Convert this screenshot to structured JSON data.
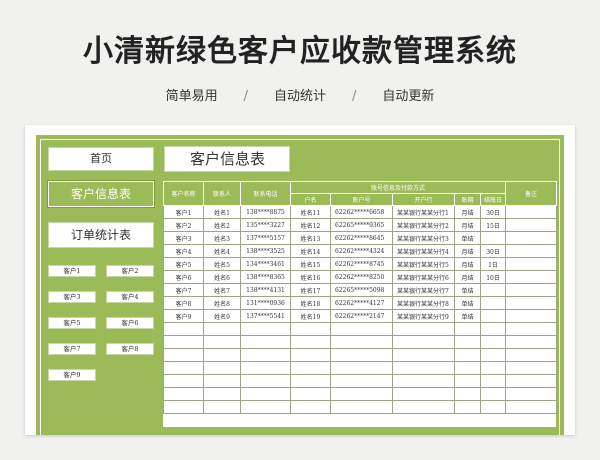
{
  "banner": {
    "title": "小清新绿色客户应收款管理系统",
    "features": [
      "简单易用",
      "自动统计",
      "自动更新"
    ],
    "separator": "/"
  },
  "nav": {
    "home": "首页",
    "page_title": "客户信息表",
    "active": "客户信息表",
    "order_stats": "订单统计表",
    "customers": [
      "客户1",
      "客户2",
      "客户3",
      "客户4",
      "客户5",
      "客户6",
      "客户7",
      "客户8",
      "客户9"
    ]
  },
  "table": {
    "headers": {
      "name": "客户名称",
      "contact": "联系人",
      "phone": "联系电话",
      "group": "账号信息及付款方式",
      "account_name": "户名",
      "account_no": "账户号",
      "bank": "开户行",
      "terms": "账期",
      "settle_day": "结账日",
      "remark": "备注"
    },
    "rows": [
      {
        "name": "客户1",
        "contact": "姓名1",
        "phone": "138****8875",
        "account_name": "姓名11",
        "account_no": "62262*****6658",
        "bank": "某某银行某某分行1",
        "terms": "月结",
        "settle_day": "30日",
        "remark": ""
      },
      {
        "name": "客户2",
        "contact": "姓名2",
        "phone": "135****3227",
        "account_name": "姓名12",
        "account_no": "62265*****9365",
        "bank": "某某银行某某分行2",
        "terms": "月结",
        "settle_day": "15日",
        "remark": ""
      },
      {
        "name": "客户3",
        "contact": "姓名3",
        "phone": "137****5157",
        "account_name": "姓名13",
        "account_no": "62262*****8645",
        "bank": "某某银行某某分行3",
        "terms": "单结",
        "settle_day": "",
        "remark": ""
      },
      {
        "name": "客户4",
        "contact": "姓名4",
        "phone": "138****3525",
        "account_name": "姓名14",
        "account_no": "62262*****4324",
        "bank": "某某银行某某分行4",
        "terms": "月结",
        "settle_day": "30日",
        "remark": ""
      },
      {
        "name": "客户5",
        "contact": "姓名5",
        "phone": "134****3461",
        "account_name": "姓名15",
        "account_no": "62262*****8745",
        "bank": "某某银行某某分行5",
        "terms": "月结",
        "settle_day": "1日",
        "remark": ""
      },
      {
        "name": "客户6",
        "contact": "姓名6",
        "phone": "138****8365",
        "account_name": "姓名16",
        "account_no": "62262*****8250",
        "bank": "某某银行某某分行6",
        "terms": "月结",
        "settle_day": "10日",
        "remark": ""
      },
      {
        "name": "客户7",
        "contact": "姓名7",
        "phone": "138****4131",
        "account_name": "姓名17",
        "account_no": "62265*****5098",
        "bank": "某某银行某某分行7",
        "terms": "单结",
        "settle_day": "",
        "remark": ""
      },
      {
        "name": "客户8",
        "contact": "姓名8",
        "phone": "131****0936",
        "account_name": "姓名18",
        "account_no": "62262*****4127",
        "bank": "某某银行某某分行8",
        "terms": "单结",
        "settle_day": "",
        "remark": ""
      },
      {
        "name": "客户9",
        "contact": "姓名9",
        "phone": "137****5541",
        "account_name": "姓名19",
        "account_no": "62262*****2147",
        "bank": "某某银行某某分行9",
        "terms": "单结",
        "settle_day": "",
        "remark": ""
      }
    ],
    "empty_rows": 7
  }
}
